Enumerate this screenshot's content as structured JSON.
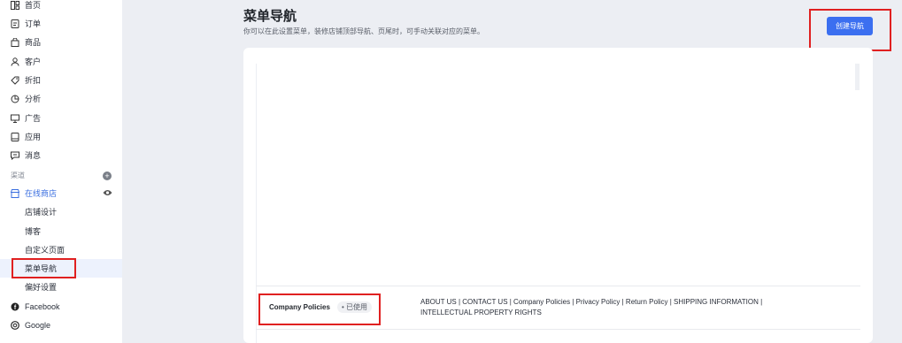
{
  "sidebar": {
    "items": [
      {
        "label": "首页",
        "icon": "dashboard-icon"
      },
      {
        "label": "订单",
        "icon": "order-icon"
      },
      {
        "label": "商品",
        "icon": "bag-icon"
      },
      {
        "label": "客户",
        "icon": "user-icon"
      },
      {
        "label": "折扣",
        "icon": "tag-icon"
      },
      {
        "label": "分析",
        "icon": "chart-icon"
      },
      {
        "label": "广告",
        "icon": "monitor-icon"
      },
      {
        "label": "应用",
        "icon": "app-icon"
      },
      {
        "label": "消息",
        "icon": "message-icon"
      }
    ],
    "channels_label": "渠道",
    "online_store": "在线商店",
    "sub_items": [
      "店铺设计",
      "博客",
      "自定义页面",
      "菜单导航",
      "偏好设置"
    ],
    "facebook": "Facebook",
    "google": "Google"
  },
  "header": {
    "title": "菜单导航",
    "description": "你可以在此设置菜单，装修店铺顶部导航、页尾时，可手动关联对应的菜单。",
    "create_button": "创建导航"
  },
  "menus": [
    {
      "name": "Company Policies",
      "status": "• 已使用",
      "items": "ABOUT US | CONTACT US | Company Policies | Privacy Policy | Return Policy | SHIPPING INFORMATION | INTELLECTUAL PROPERTY RIGHTS"
    }
  ],
  "colors": {
    "accent": "#3b6ff0",
    "highlight": "#e02020"
  }
}
